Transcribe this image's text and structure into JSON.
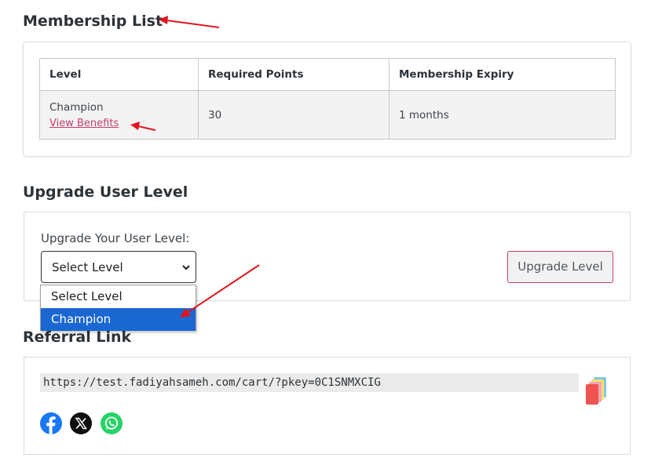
{
  "membership": {
    "heading": "Membership List",
    "columns": [
      "Level",
      "Required Points",
      "Membership Expiry"
    ],
    "rows": [
      {
        "level": "Champion",
        "benefits_link": "View Benefits",
        "points": "30",
        "expiry": "1 months"
      }
    ]
  },
  "upgrade": {
    "heading": "Upgrade User Level",
    "label": "Upgrade Your User Level:",
    "selected_value": "Select Level",
    "options": [
      "Select Level",
      "Champion"
    ],
    "highlighted_option": "Champion",
    "button_label": "Upgrade Level"
  },
  "referral": {
    "heading": "Referral Link",
    "url": "https://test.fadiyahsameh.com/cart/?pkey=0C1SNMXCIG",
    "copy_icon": "copy-clipboard-icon",
    "share_icons": [
      "facebook-icon",
      "x-twitter-icon",
      "whatsapp-icon"
    ]
  },
  "colors": {
    "link": "#c2406d",
    "selected_option": "#1a67d2",
    "annotation_arrow": "#e0161c",
    "facebook": "#1877f2",
    "whatsapp": "#25d366"
  }
}
